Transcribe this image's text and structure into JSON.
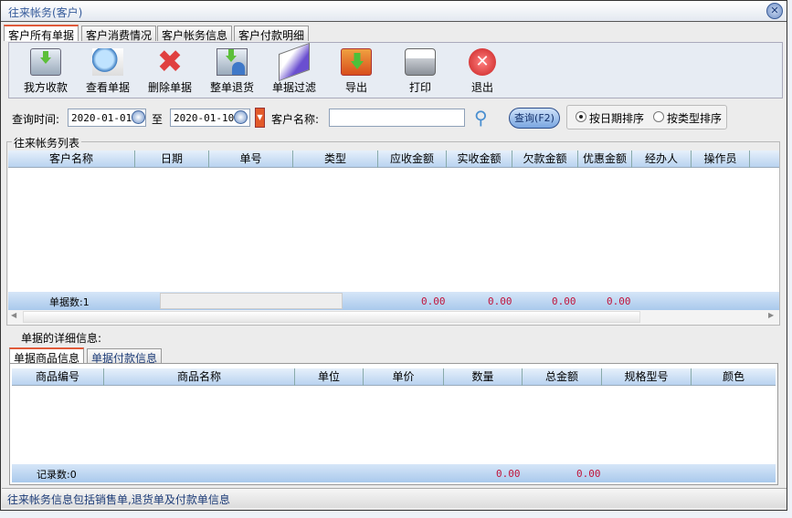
{
  "window": {
    "title": "往来帐务(客户)",
    "close": "✕"
  },
  "tabs": [
    "客户所有单据",
    "客户消费情况",
    "客户帐务信息",
    "客户付款明细"
  ],
  "toolbar": [
    "我方收款",
    "查看单据",
    "删除单据",
    "整单退货",
    "单据过滤",
    "导出",
    "打印",
    "退出"
  ],
  "query": {
    "time_label": "查询时间:",
    "date_from": "2020-01-01",
    "to_label": "至",
    "date_to": "2020-01-10",
    "customer_label": "客户名称:",
    "customer_value": "",
    "search_button": "查询(F2)",
    "sort_date": "按日期排序",
    "sort_type": "按类型排序",
    "sort_selected": "date"
  },
  "list": {
    "title": "往来帐务列表",
    "columns": [
      "客户名称",
      "日期",
      "单号",
      "类型",
      "应收金额",
      "实收金额",
      "欠款金额",
      "优惠金额",
      "经办人",
      "操作员"
    ],
    "footer": {
      "count": "单据数:1",
      "receivable": "0.00",
      "received": "0.00",
      "owed": "0.00",
      "discount": "0.00"
    }
  },
  "detail": {
    "label": "单据的详细信息:",
    "tabs": [
      "单据商品信息",
      "单据付款信息"
    ],
    "columns": [
      "商品编号",
      "商品名称",
      "单位",
      "单价",
      "数量",
      "总金额",
      "规格型号",
      "颜色"
    ],
    "footer": {
      "count": "记录数:0",
      "quantity": "0.00",
      "total": "0.00"
    }
  },
  "status": "往来帐务信息包括销售单,退货单及付款单信息"
}
